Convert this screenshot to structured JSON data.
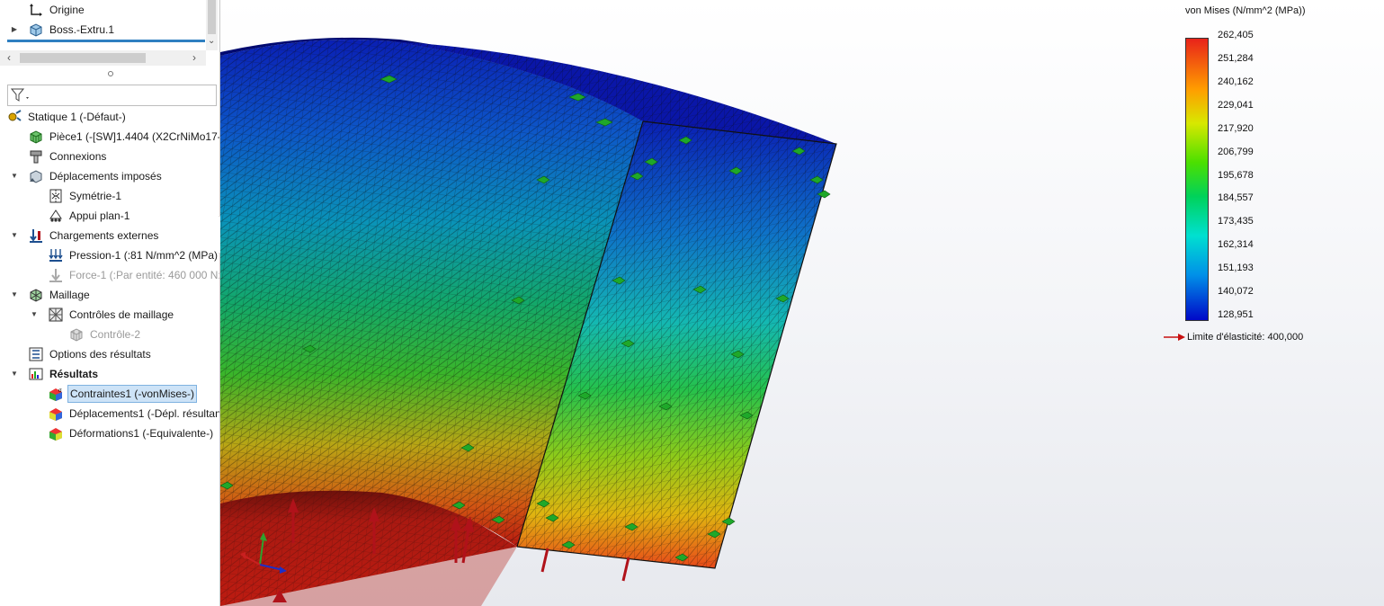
{
  "tree_top": {
    "items": [
      {
        "label": "Origine"
      },
      {
        "label": "Boss.-Extru.1"
      }
    ]
  },
  "study_tree": {
    "items": [
      {
        "label": "Statique 1 (-Défaut-)"
      },
      {
        "label": "Pièce1 (-[SW]1.4404 (X2CrNiMo17-1"
      },
      {
        "label": "Connexions"
      },
      {
        "label": "Déplacements imposés"
      },
      {
        "label": "Symétrie-1"
      },
      {
        "label": "Appui plan-1"
      },
      {
        "label": "Chargements externes"
      },
      {
        "label": "Pression-1 (:81 N/mm^2 (MPa)"
      },
      {
        "label": "Force-1 (:Par entité: 460 000 N:)"
      },
      {
        "label": "Maillage"
      },
      {
        "label": "Contrôles de maillage"
      },
      {
        "label": "Contrôle-2"
      },
      {
        "label": "Options des résultats"
      },
      {
        "label": "Résultats"
      },
      {
        "label": "Contraintes1 (-vonMises-)"
      },
      {
        "label": "Déplacements1 (-Dépl. résultan"
      },
      {
        "label": "Déformations1 (-Equivalente-)"
      }
    ]
  },
  "legend": {
    "title": "von Mises (N/mm^2 (MPa))",
    "ticks": [
      "262,405",
      "251,284",
      "240,162",
      "229,041",
      "217,920",
      "206,799",
      "195,678",
      "184,557",
      "173,435",
      "162,314",
      "151,193",
      "140,072",
      "128,951"
    ],
    "yield_label": "Limite d'élasticité: 400,000",
    "max_color": "#e8231a",
    "min_color": "#0008c8"
  },
  "colors": {
    "selection_bg": "#cde3f7",
    "accent_line": "#2f7fc1",
    "fixture_green": "#1fa82a",
    "load_arrow": "#b0121a"
  }
}
